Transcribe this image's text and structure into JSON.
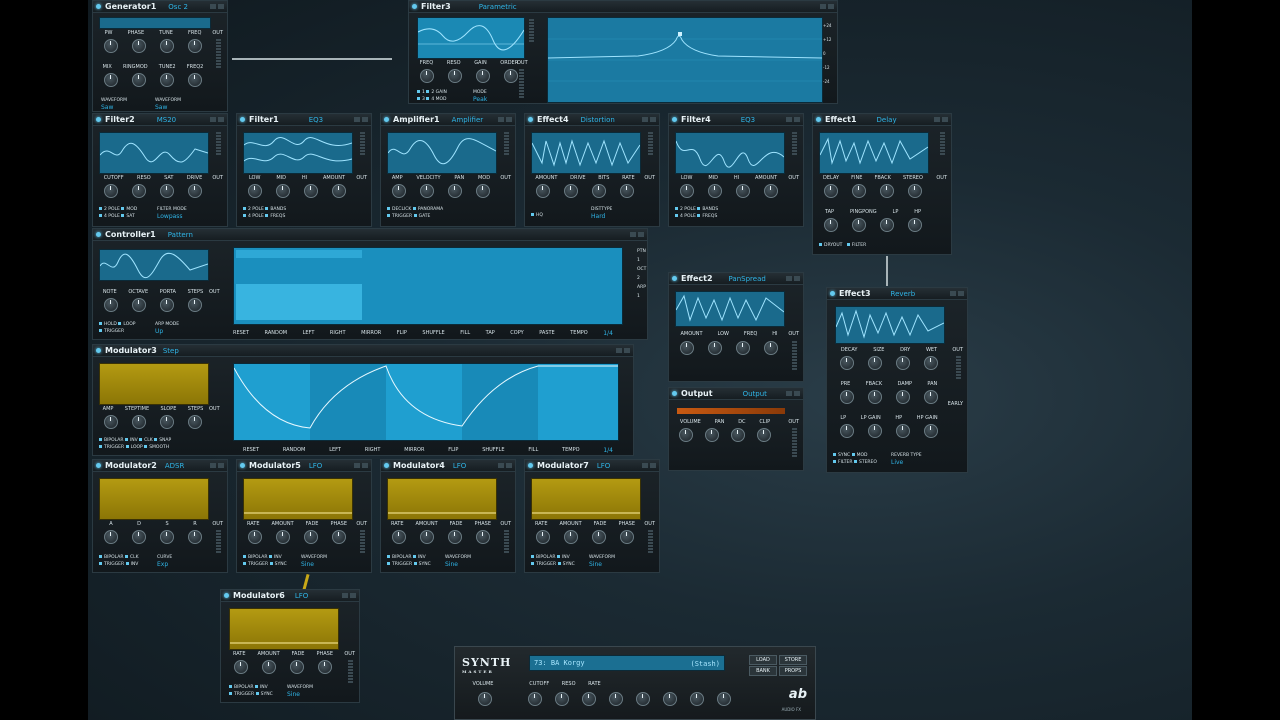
{
  "colors": {
    "accent": "#2fb4e6",
    "display_blue": "#1a6a8c",
    "display_yellow": "#b49a12",
    "panel": "#161d21"
  },
  "modules": {
    "generator1": {
      "name": "Generator1",
      "type": "Osc 2",
      "knobs1": [
        "PW",
        "PHASE",
        "TUNE",
        "FREQ"
      ],
      "knobs2": [
        "MIX",
        "RINGMOD",
        "TUNE2",
        "FREQ2"
      ],
      "wf_label1": "WAVEFORM",
      "wf_label2": "WAVEFORM",
      "wf1": "Saw",
      "wf2": "Saw",
      "out": "OUT"
    },
    "filter3": {
      "name": "Filter3",
      "type": "Parametric",
      "knobs": [
        "FREQ",
        "RESO",
        "GAIN",
        "ORDER"
      ],
      "mode_label": "MODE",
      "mode": "Peak",
      "out": "OUT",
      "opt1": "1",
      "opt2": "2",
      "opt3": "3",
      "opt4": "4",
      "gain": "GAIN",
      "mod": "MOD",
      "scale": [
        "+24",
        "+12",
        "0",
        "-12",
        "-24"
      ]
    },
    "filter2": {
      "name": "Filter2",
      "type": "MS20",
      "knobs": [
        "CUTOFF",
        "RESO",
        "SAT",
        "DRIVE"
      ],
      "o1": "2 POLE",
      "o2": "4 POLE",
      "o3": "MOD",
      "o4": "SAT",
      "fm_label": "FILTER MODE",
      "fm": "Lowpass",
      "out": "OUT"
    },
    "filter1": {
      "name": "Filter1",
      "type": "EQ3",
      "knobs": [
        "LOW",
        "MID",
        "HI",
        "AMOUNT"
      ],
      "o1": "2 POLE",
      "o2": "4 POLE",
      "o3": "BANDS",
      "o4": "FREQS",
      "out": "OUT"
    },
    "amplifier1": {
      "name": "Amplifier1",
      "type": "Amplifier",
      "knobs": [
        "AMP",
        "VELOCITY",
        "PAN",
        "MOD"
      ],
      "o1": "DECLICK",
      "o2": "TRIGGER",
      "o3": "PANORAMA",
      "o4": "GATE",
      "out": "OUT"
    },
    "effect4": {
      "name": "Effect4",
      "type": "Distortion",
      "knobs": [
        "AMOUNT",
        "DRIVE",
        "BITS",
        "RATE"
      ],
      "o1": "HQ",
      "dt_label": "DISTTYPE",
      "dt": "Hard",
      "out": "OUT"
    },
    "filter4": {
      "name": "Filter4",
      "type": "EQ3",
      "knobs": [
        "LOW",
        "MID",
        "HI",
        "AMOUNT"
      ],
      "o1": "2 POLE",
      "o2": "4 POLE",
      "o3": "BANDS",
      "o4": "FREQS",
      "out": "OUT"
    },
    "effect1": {
      "name": "Effect1",
      "type": "Delay",
      "knobs": [
        "DELAY",
        "FINE",
        "FBACK",
        "STEREO"
      ],
      "knobs2": [
        "TAP",
        "PINGPONG",
        "LP",
        "HP"
      ],
      "o1": "DRYOUT",
      "o2": "FILTER",
      "out": "OUT"
    },
    "controller1": {
      "name": "Controller1",
      "type": "Pattern",
      "knobs": [
        "NOTE",
        "OCTAVE",
        "PORTA",
        "STEPS"
      ],
      "o1": "HOLD",
      "o2": "LOOP",
      "o3": "TRIGGER",
      "am_label": "ARP MODE",
      "am": "Up",
      "out": "OUT",
      "side": [
        "PTN",
        "1",
        "OCT",
        "2",
        "ARP",
        "1"
      ],
      "tb": [
        "RESET",
        "RANDOM",
        "LEFT",
        "RIGHT",
        "MIRROR",
        "FLIP",
        "SHUFFLE",
        "FILL",
        "TAP",
        "COPY",
        "PASTE",
        "TEMPO"
      ],
      "tempo": "1/4"
    },
    "effect2": {
      "name": "Effect2",
      "type": "PanSpread",
      "knobs": [
        "AMOUNT",
        "LOW",
        "FREQ",
        "HI"
      ],
      "out": "OUT"
    },
    "effect3": {
      "name": "Effect3",
      "type": "Reverb",
      "knobs": [
        "DECAY",
        "SIZE",
        "DRY",
        "WET"
      ],
      "knobs2": [
        "PRE",
        "FBACK",
        "DAMP",
        "PAN"
      ],
      "knobs3": [
        "LP",
        "LP GAIN",
        "HP",
        "HP GAIN"
      ],
      "early": "EARLY",
      "o1": "SYNC",
      "o2": "FILTER",
      "o3": "MOD",
      "o4": "STEREO",
      "rt_label": "REVERB TYPE",
      "rt": "Live",
      "out": "OUT"
    },
    "modulator3": {
      "name": "Modulator3",
      "type": "Step",
      "knobs": [
        "AMP",
        "STEPTIME",
        "SLOPE",
        "STEPS"
      ],
      "o1": "BIPOLAR",
      "o2": "TRIGGER",
      "o3": "INV",
      "o4": "LOOP",
      "o5": "CLK",
      "o6": "SMOOTH",
      "o7": "SNAP",
      "out": "OUT",
      "tb": [
        "RESET",
        "RANDOM",
        "LEFT",
        "RIGHT",
        "MIRROR",
        "FLIP",
        "SHUFFLE",
        "FILL",
        "TEMPO"
      ],
      "tempo": "1/4"
    },
    "output": {
      "name": "Output",
      "type": "Output",
      "knobs": [
        "VOLUME",
        "PAN",
        "DC",
        "CLIP"
      ],
      "out": "OUT"
    },
    "modulator2": {
      "name": "Modulator2",
      "type": "ADSR",
      "knobs": [
        "A",
        "D",
        "S",
        "R"
      ],
      "o1": "BIPOLAR",
      "o2": "TRIGGER",
      "o3": "CLK",
      "o4": "INV",
      "c_label": "CURVE",
      "c": "Exp",
      "out": "OUT"
    },
    "modulator5": {
      "name": "Modulator5",
      "type": "LFO",
      "knobs": [
        "RATE",
        "AMOUNT",
        "FADE",
        "PHASE"
      ],
      "o1": "BIPOLAR",
      "o2": "TRIGGER",
      "o3": "INV",
      "o4": "SYNC",
      "w_label": "WAVEFORM",
      "w": "Sine",
      "out": "OUT"
    },
    "modulator4": {
      "name": "Modulator4",
      "type": "LFO",
      "knobs": [
        "RATE",
        "AMOUNT",
        "FADE",
        "PHASE"
      ],
      "o1": "BIPOLAR",
      "o2": "TRIGGER",
      "o3": "INV",
      "o4": "SYNC",
      "w_label": "WAVEFORM",
      "w": "Sine",
      "out": "OUT"
    },
    "modulator7": {
      "name": "Modulator7",
      "type": "LFO",
      "knobs": [
        "RATE",
        "AMOUNT",
        "FADE",
        "PHASE"
      ],
      "o1": "BIPOLAR",
      "o2": "TRIGGER",
      "o3": "INV",
      "o4": "SYNC",
      "w_label": "WAVEFORM",
      "w": "Sine",
      "out": "OUT"
    },
    "modulator6": {
      "name": "Modulator6",
      "type": "LFO",
      "knobs": [
        "RATE",
        "AMOUNT",
        "FADE",
        "PHASE"
      ],
      "o1": "BIPOLAR",
      "o2": "TRIGGER",
      "o3": "INV",
      "o4": "SYNC",
      "w_label": "WAVEFORM",
      "w": "Sine",
      "out": "OUT"
    }
  },
  "master": {
    "logo": "SYNTH",
    "logo_sub": "MASTER",
    "preset": "73: BA Korgy",
    "preset_bank": "(Stash)",
    "load": "LOAD",
    "store": "STORE",
    "bank": "BANK",
    "props": "PROPS",
    "knobs": [
      "VOLUME",
      "CUTOFF",
      "RESO",
      "RATE"
    ],
    "brand": "ab",
    "brand_sub": "AUDIO FX"
  }
}
